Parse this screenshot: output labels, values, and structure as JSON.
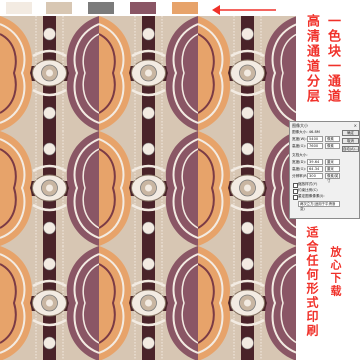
{
  "colors": {
    "swatches": [
      "#f3ebe2",
      "#d8c7b3",
      "#7b7b7b",
      "#8a5665",
      "#e7a36a"
    ],
    "accent_red": "#f0312a"
  },
  "captions": {
    "line1": "高清通道分层",
    "line2": "一色块一通道",
    "line3": "放心下载",
    "line4": "适合任何形式印刷"
  },
  "dialog": {
    "title": "图像大小",
    "close": "×",
    "info": "图像大小: 46.8M",
    "width_label": "宽度(W):",
    "width_value": "5400",
    "height_label": "高度(G):",
    "height_value": "7600",
    "unit_px": "像素",
    "doc_size": "文档大小:",
    "doc_width_label": "宽度(D):",
    "doc_width_value": "39.64",
    "doc_height_label": "高度(G):",
    "doc_height_value": "64.34",
    "res_label": "分辨率(R):",
    "res_value": "300",
    "unit_cm": "厘米",
    "unit_ppi": "像素/英寸",
    "scale_styles": "缩放样式(Y)",
    "constrain": "约束比例(C)",
    "resample": "重定图像像素(I):",
    "resample_method": "两次立方(适用于平滑渐变)",
    "ok": "确定",
    "cancel": "取消",
    "auto": "自动(A)..."
  }
}
